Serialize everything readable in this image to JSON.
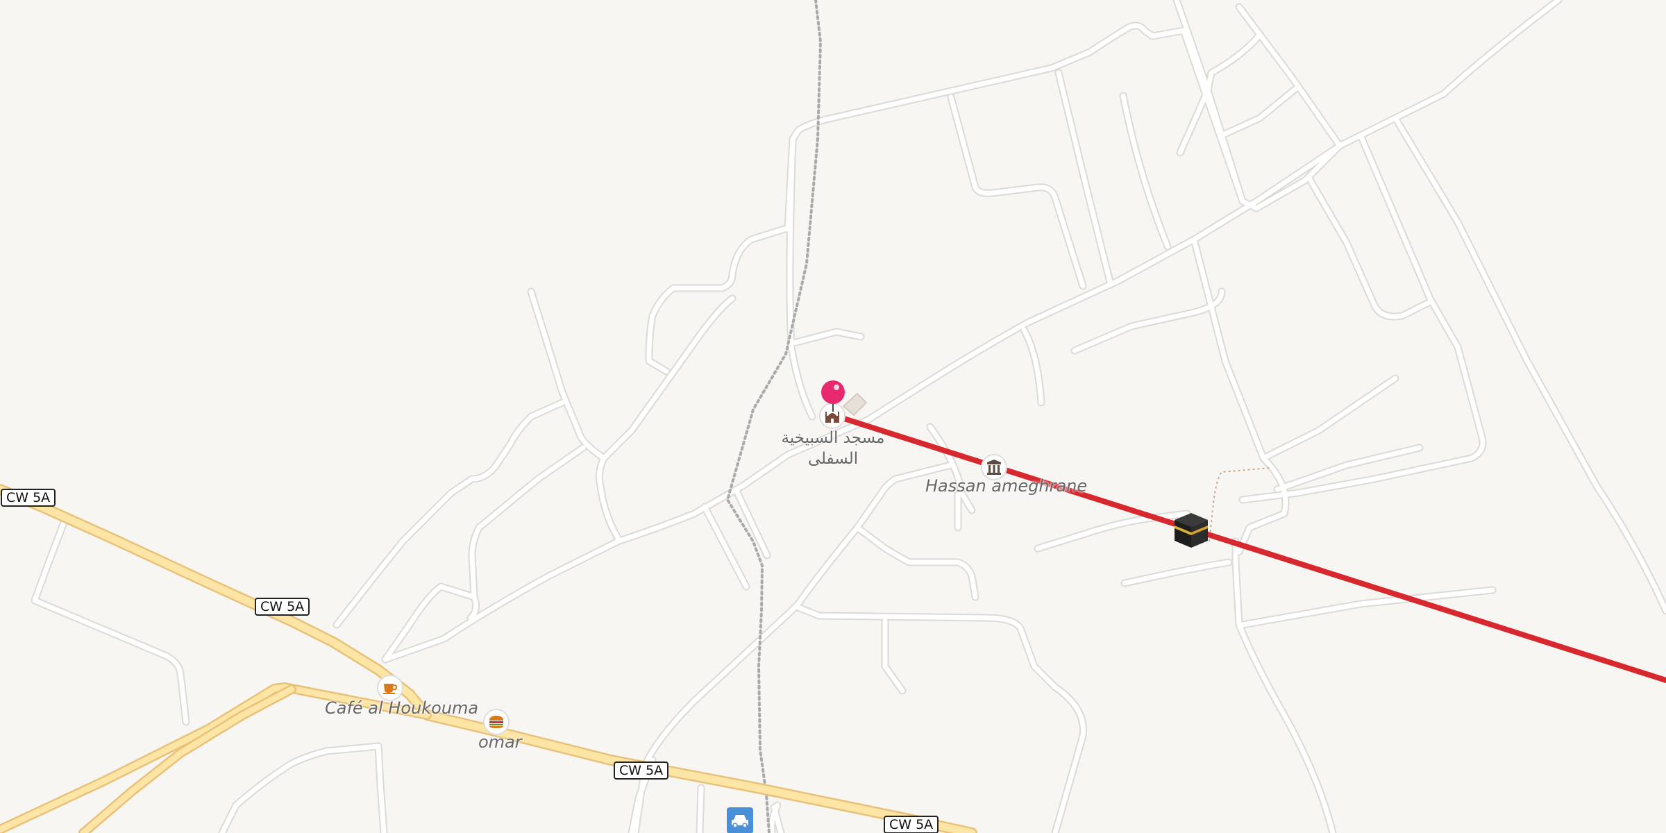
{
  "map": {
    "road_shields": [
      "CW 5A",
      "CW 5A",
      "CW 5A",
      "CW 5A"
    ],
    "places": {
      "mosque_name_line1": "مسجد السبيخية",
      "mosque_name_line2": "السفلى",
      "hassan": "Hassan ameghrane",
      "cafe": "Café al Houkouma",
      "omar": "omar"
    },
    "icons": {
      "pin": "marker-pin-icon",
      "mosque": "mosque-icon",
      "building": "building-icon",
      "cafe": "coffee-cup-icon",
      "fastfood": "burger-icon",
      "parking": "car-icon",
      "kaaba": "kaaba-icon"
    },
    "colors": {
      "background": "#f8f6f3",
      "minor_road": "#ffffff",
      "road_casing": "#dcdad6",
      "primary_road": "#fde5a6",
      "primary_casing": "#e8c27a",
      "qibla_line": "#d7282f",
      "pin": "#e8286e",
      "path": "#aaaaaa"
    }
  }
}
